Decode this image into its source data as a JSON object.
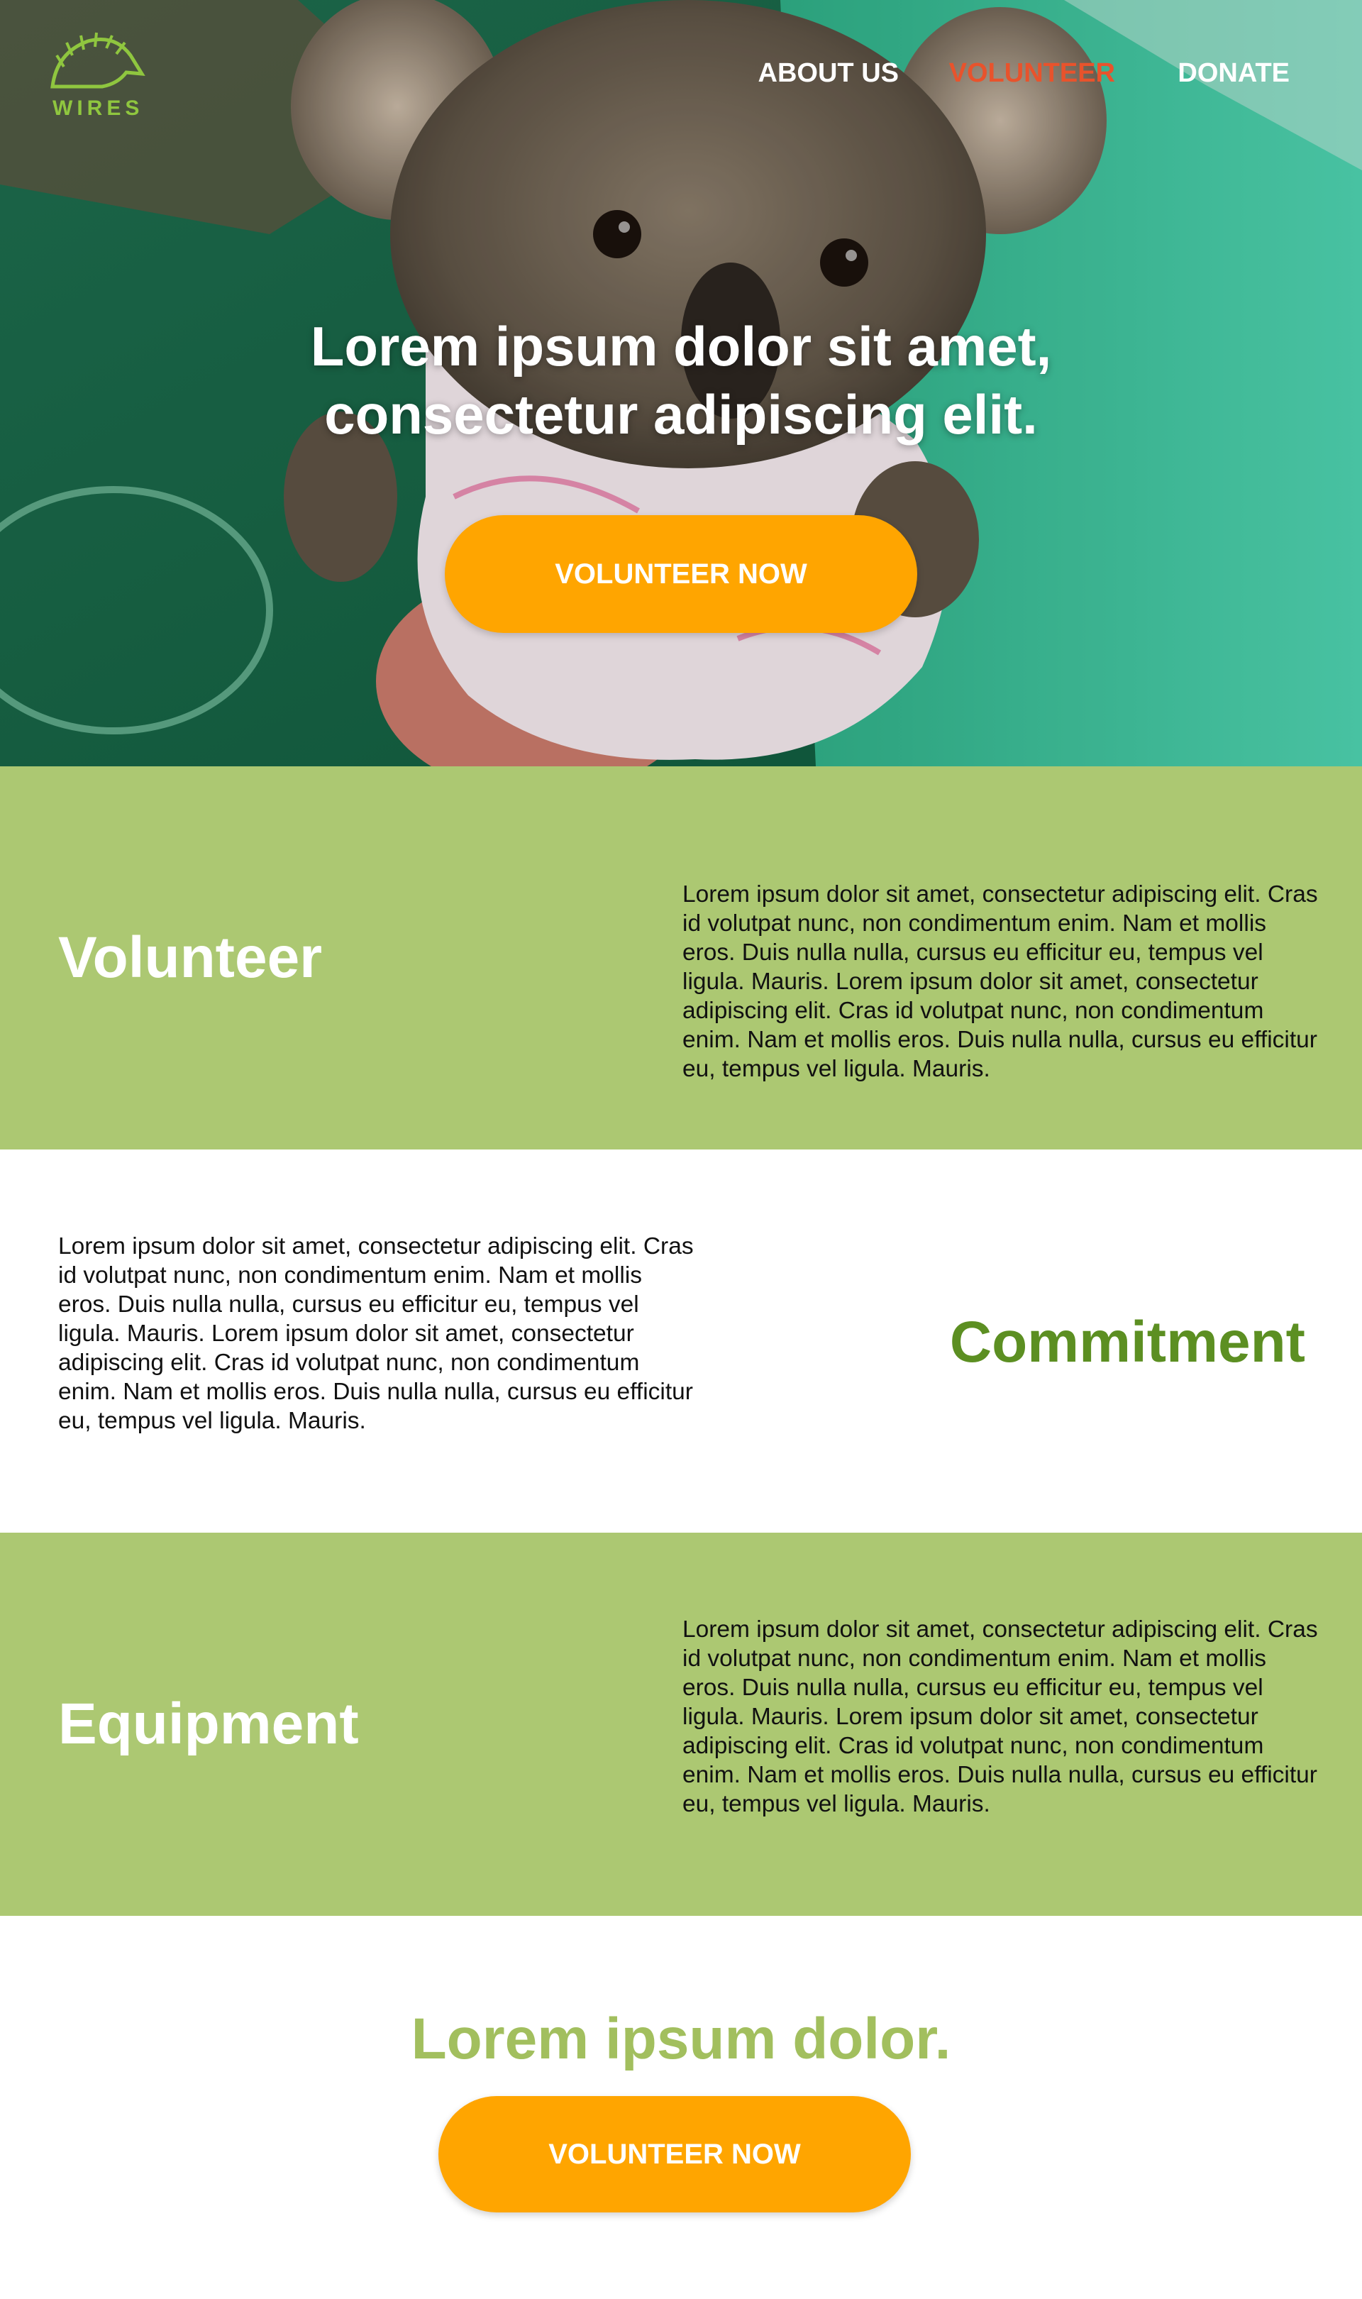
{
  "brand": {
    "name": "WIRES",
    "logo_icon": "echidna-icon",
    "accent": "#8fc63f"
  },
  "nav": {
    "items": [
      {
        "label": "ABOUT US",
        "active": false
      },
      {
        "label": "VOLUNTEER",
        "active": true
      },
      {
        "label": "DONATE",
        "active": false
      }
    ]
  },
  "hero": {
    "title_line1": "Lorem ipsum dolor sit amet,",
    "title_line2": "consectetur adipiscing elit.",
    "cta_label": "VOLUNTEER NOW"
  },
  "sections": [
    {
      "title": "Volunteer",
      "text": "Lorem ipsum dolor sit amet, consectetur adipiscing elit. Cras id volutpat nunc, non condimentum enim. Nam et mollis eros. Duis nulla nulla, cursus eu efficitur eu, tempus vel ligula. Mauris. Lorem ipsum dolor sit amet, consectetur adipiscing elit. Cras id volutpat nunc, non condimentum enim. Nam et mollis eros. Duis nulla nulla, cursus eu efficitur eu, tempus vel ligula. Mauris."
    },
    {
      "title": "Commitment",
      "text": "Lorem ipsum dolor sit amet, consectetur adipiscing elit. Cras id volutpat nunc, non condimentum enim. Nam et mollis eros. Duis nulla nulla, cursus eu efficitur eu, tempus vel ligula. Mauris. Lorem ipsum dolor sit amet, consectetur adipiscing elit. Cras id volutpat nunc, non condimentum enim. Nam et mollis eros. Duis nulla nulla, cursus eu efficitur eu, tempus vel ligula. Mauris."
    },
    {
      "title": "Equipment",
      "text": "Lorem ipsum dolor sit amet, consectetur adipiscing elit. Cras id volutpat nunc, non condimentum enim. Nam et mollis eros. Duis nulla nulla, cursus eu efficitur eu, tempus vel ligula. Mauris. Lorem ipsum dolor sit amet, consectetur adipiscing elit. Cras id volutpat nunc, non condimentum enim. Nam et mollis eros. Duis nulla nulla, cursus eu efficitur eu, tempus vel ligula. Mauris."
    }
  ],
  "footer": {
    "heading": "Lorem ipsum dolor.",
    "cta_label": "VOLUNTEER NOW"
  },
  "colors": {
    "section_green": "#acc872",
    "cta_orange": "#ffa500",
    "nav_active": "#e8532c",
    "title_green": "#5c8f22",
    "footer_heading": "#a2bf5e"
  }
}
